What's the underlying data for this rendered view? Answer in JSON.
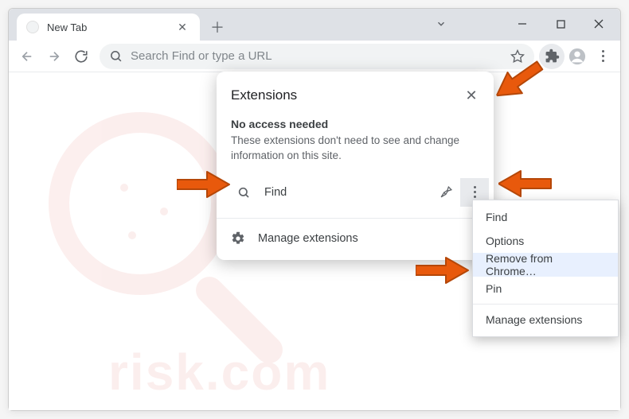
{
  "tab": {
    "title": "New Tab"
  },
  "omnibox": {
    "placeholder": "Search Find or type a URL"
  },
  "ext_popup": {
    "title": "Extensions",
    "sub_title": "No access needed",
    "sub_desc": "These extensions don't need to see and change information on this site.",
    "item_name": "Find",
    "manage_label": "Manage extensions"
  },
  "ctx": {
    "find": "Find",
    "options": "Options",
    "remove": "Remove from Chrome…",
    "pin": "Pin",
    "manage": "Manage extensions"
  },
  "watermark_text": "risk.com"
}
